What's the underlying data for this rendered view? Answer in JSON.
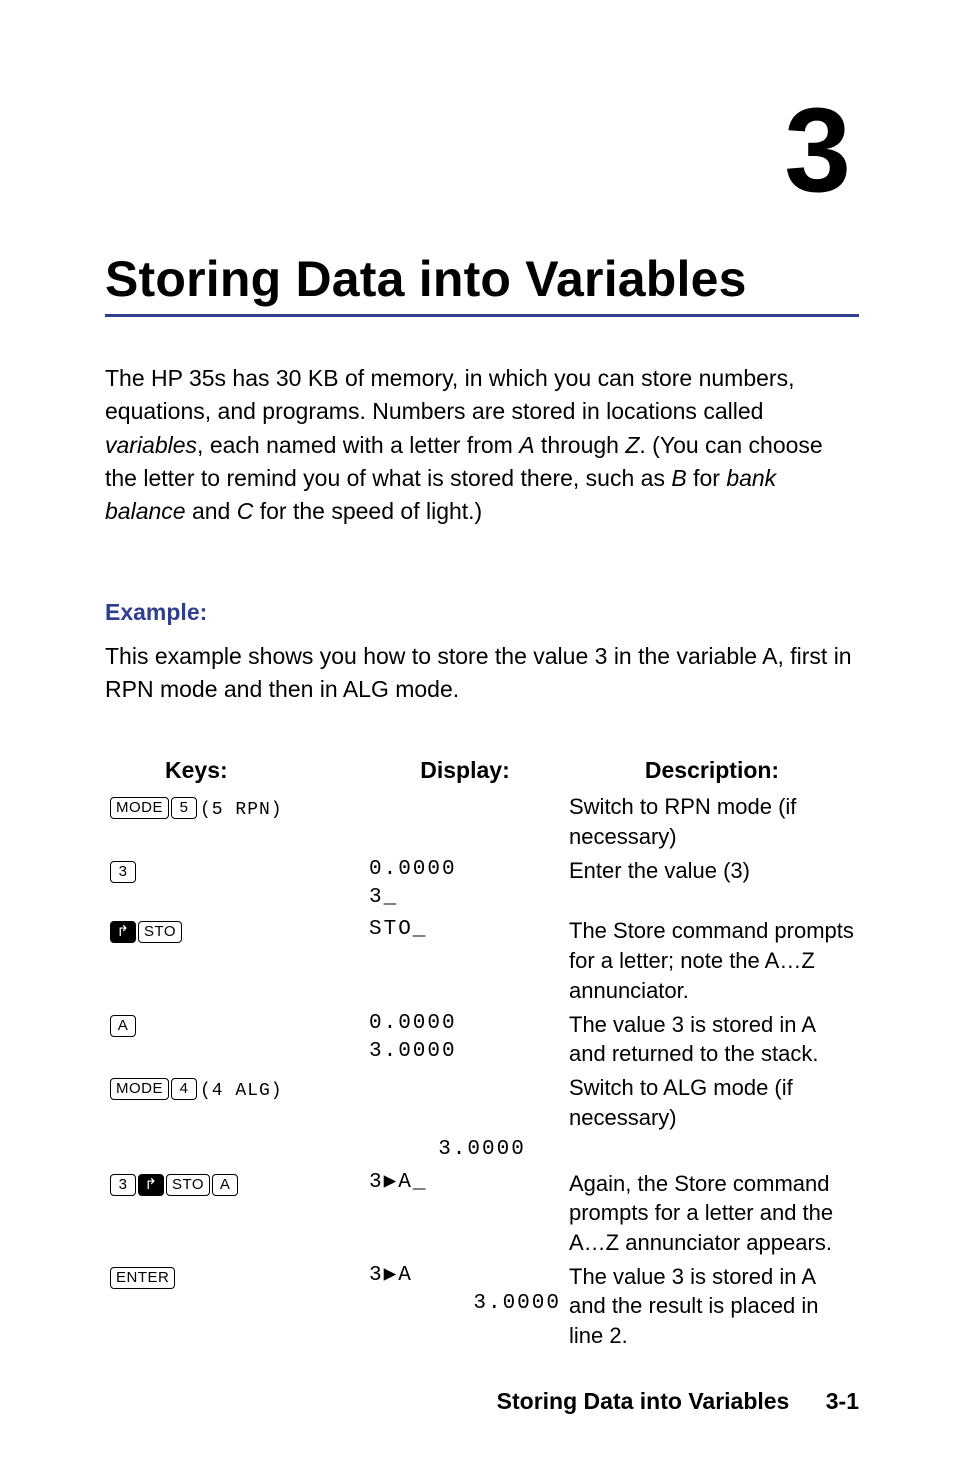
{
  "chapter_number": "3",
  "title": "Storing Data into Variables",
  "intro": {
    "t1": "The HP 35s has 30 KB of memory, in which you can store numbers, equations, and programs. Numbers are stored in locations called ",
    "i1": "variables",
    "t2": ", each named with a letter from ",
    "i2": "A",
    "t3": " through ",
    "i3": "Z",
    "t4": ". (You can choose the letter to remind you of what is stored there, such as ",
    "i4": "B",
    "t5": " for ",
    "i5": "bank balance",
    "t6": " and ",
    "i6": "C",
    "t7": " for the speed of light.)"
  },
  "example_heading": "Example:",
  "example_text": "This example shows you how to store the value 3 in the variable A, first in RPN mode and then in ALG mode.",
  "headers": {
    "keys": "Keys:",
    "display": "Display:",
    "description": "Description:"
  },
  "rows": {
    "r1": {
      "keys": {
        "k1": "MODE",
        "k2": "5",
        "suffix": "(5 RPN)"
      },
      "display": "",
      "desc": "Switch to RPN mode (if necessary)"
    },
    "r2": {
      "keys": {
        "k1": "3"
      },
      "display_a": "0.0000",
      "display_b": "3_",
      "desc": "Enter the value (3)"
    },
    "r3": {
      "keys": {
        "k1": "↱",
        "k2": "STO"
      },
      "display_a": "",
      "display_b": "STO_",
      "desc": "The Store command prompts for a letter; note the A…Z annunciator."
    },
    "r4": {
      "keys": {
        "k1": "A"
      },
      "display_a": "0.0000",
      "display_b": "3.0000",
      "desc": "The value 3 is stored in A and returned to the stack."
    },
    "r5": {
      "keys": {
        "k1": "MODE",
        "k2": "4",
        "suffix": "(4 ALG)"
      },
      "display": "3.0000",
      "desc": "Switch to ALG mode (if necessary)"
    },
    "r6": {
      "keys": {
        "k1": "3",
        "k2": "↱",
        "k3": "STO",
        "k4": "A"
      },
      "display": "3▶A_",
      "desc": "Again, the Store command prompts for a letter and the A…Z annunciator appears."
    },
    "r7": {
      "keys": {
        "k1": "ENTER"
      },
      "display_a": "3▶A",
      "display_b": "3.0000",
      "desc": "The value 3 is stored in A and the result is placed in line 2."
    }
  },
  "footer": {
    "title": "Storing Data into Variables",
    "page": "3-1"
  }
}
